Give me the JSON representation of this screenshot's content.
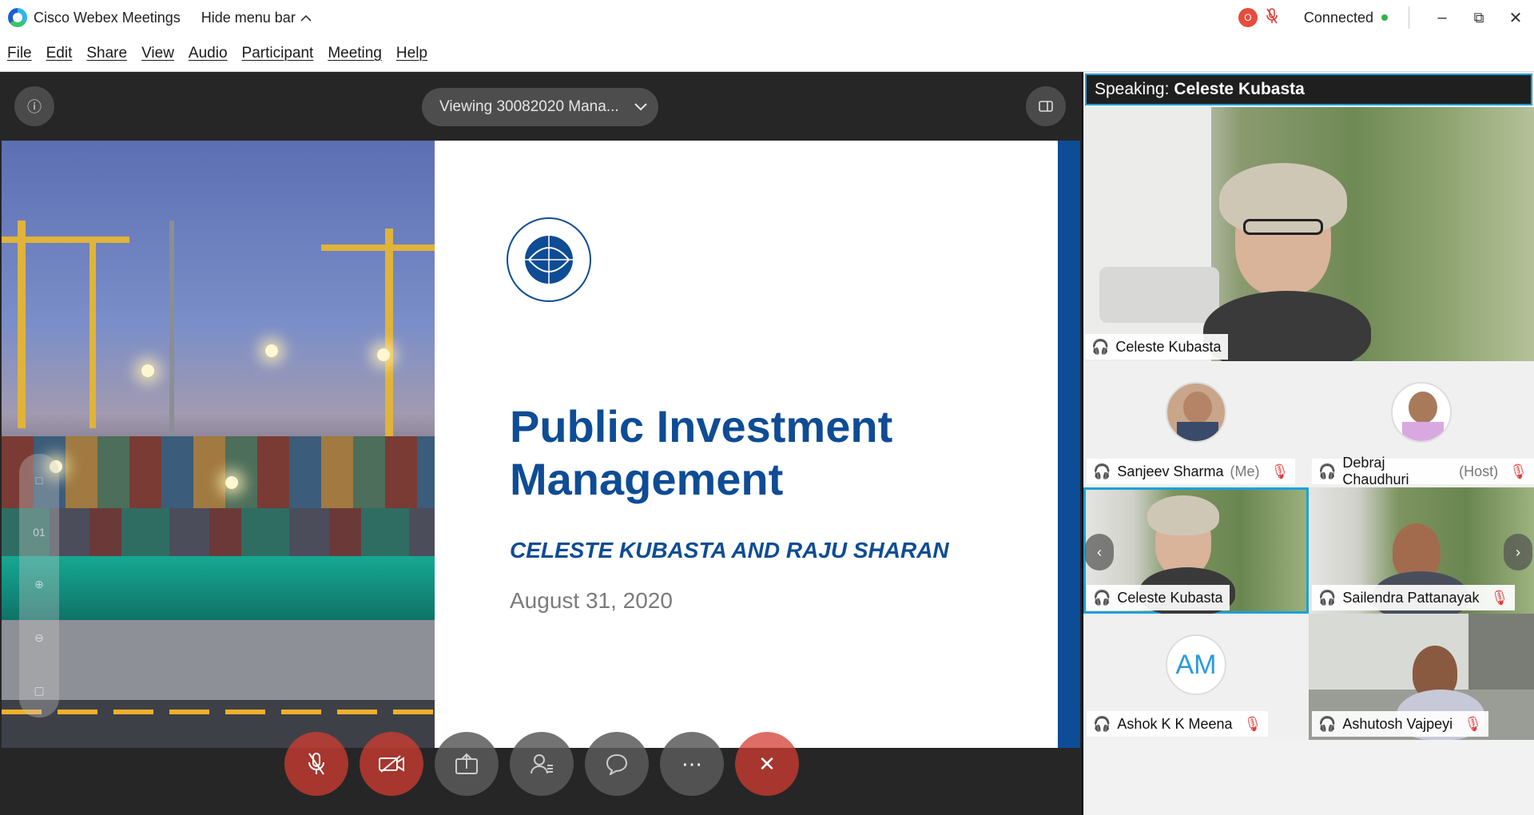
{
  "titlebar": {
    "app_name": "Cisco Webex Meetings",
    "hide_menu": "Hide menu bar",
    "rec_label": "O",
    "connection_status": "Connected"
  },
  "menu": [
    "File",
    "Edit",
    "Share",
    "View",
    "Audio",
    "Participant",
    "Meeting",
    "Help"
  ],
  "content": {
    "viewing_label": "Viewing 30082020 Mana...",
    "slide": {
      "title_line1": "Public Investment",
      "title_line2": "Management",
      "authors": "CELESTE KUBASTA AND RAJU SHARAN",
      "date": "August 31, 2020",
      "logo_text": "INTERNATIONAL MONETARY FUND",
      "page_indicator": "01"
    }
  },
  "panel": {
    "speaking_prefix": "Speaking:",
    "speaking_name": "Celeste Kubasta",
    "active_name": "Celeste Kubasta",
    "participants": [
      {
        "name": "Sanjeev Sharma",
        "role": "(Me)",
        "muted": true,
        "type": "avatar"
      },
      {
        "name": "Debraj Chaudhuri",
        "role": "(Host)",
        "muted": true,
        "type": "avatar"
      },
      {
        "name": "Celeste Kubasta",
        "role": "",
        "muted": false,
        "type": "video",
        "selected": true
      },
      {
        "name": "Sailendra Pattanayak",
        "role": "",
        "muted": true,
        "type": "video"
      },
      {
        "name": "Ashok K K Meena",
        "role": "",
        "muted": true,
        "type": "initials",
        "initials": "AM"
      },
      {
        "name": "Ashutosh Vajpeyi",
        "role": "",
        "muted": true,
        "type": "video"
      }
    ]
  },
  "colors": {
    "accent": "#1ea0d8",
    "slide_blue": "#0e4c95",
    "end_red": "#d23c32"
  }
}
